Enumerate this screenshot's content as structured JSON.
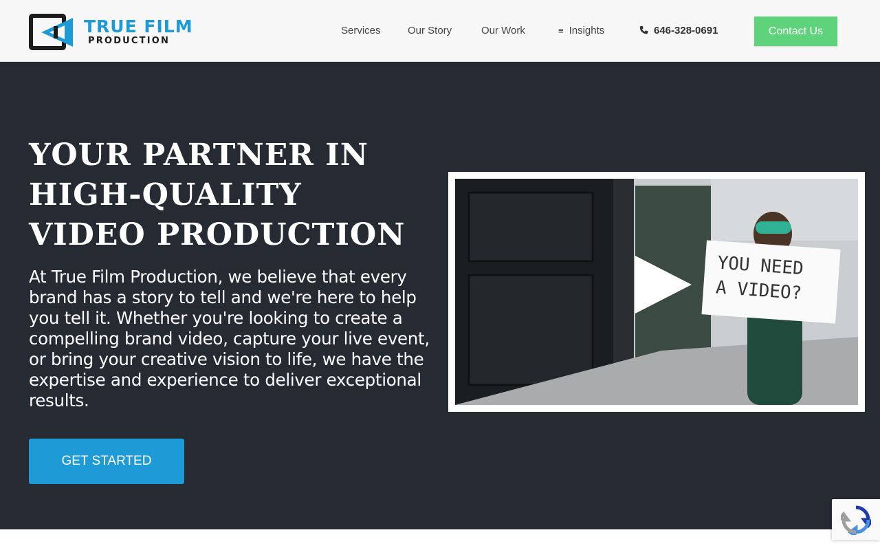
{
  "header": {
    "logo": {
      "title": "TRUE FILM",
      "subtitle": "PRODUCTION"
    },
    "nav": {
      "services": "Services",
      "our_story": "Our Story",
      "our_work": "Our Work",
      "insights": "Insights",
      "phone": "646-328-0691"
    },
    "contact_label": "Contact Us"
  },
  "hero": {
    "title": "YOUR PARTNER IN HIGH-QUALITY VIDEO PRODUCTION",
    "text": "At True Film Production, we believe that every brand has a story to tell and we're here to help you tell it. Whether you're looking to create a compelling brand video, capture your live event, or bring your creative vision to life, we have the expertise and experience to deliver exceptional results.",
    "cta_label": "GET STARTED",
    "video": {
      "sign_line1": "YOU NEED",
      "sign_line2": "A VIDEO?"
    }
  },
  "icons": {
    "insights": "menu-icon",
    "phone": "phone-icon",
    "play": "play-icon",
    "recaptcha": "recaptcha-icon"
  },
  "colors": {
    "brand_blue": "#1e9ad6",
    "contact_green": "#5fd37b",
    "hero_bg": "#262a32",
    "header_bg": "#f7f7f7"
  }
}
